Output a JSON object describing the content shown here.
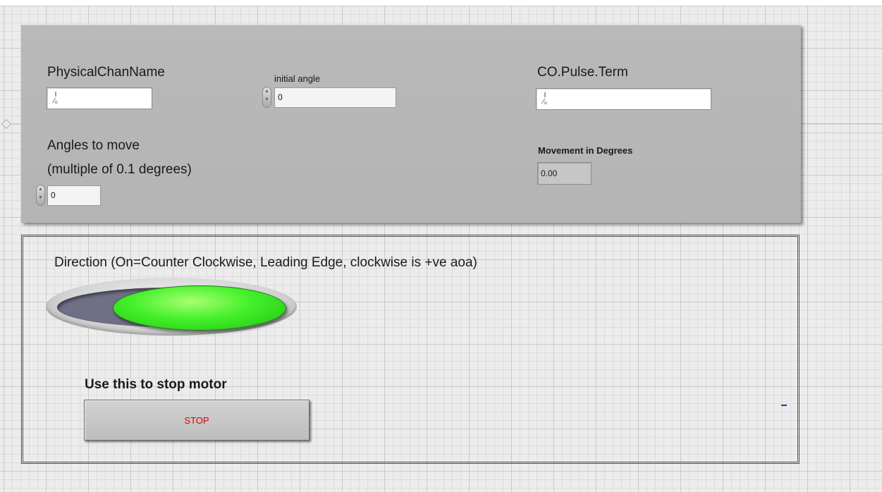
{
  "controls": {
    "physical_chan": {
      "label": "PhysicalChanName",
      "value": ""
    },
    "initial_angle": {
      "label": "initial angle",
      "value": "0"
    },
    "co_pulse_term": {
      "label": "CO.Pulse.Term",
      "value": ""
    },
    "angles_to_move": {
      "label_line1": "Angles to move",
      "label_line2": "(multiple of 0.1 degrees)",
      "value": "0"
    },
    "movement": {
      "label": "Movement in Degrees",
      "value": "0.00"
    }
  },
  "direction": {
    "label": "Direction (On=Counter Clockwise, Leading Edge,  clockwise is +ve aoa)",
    "state_on": true,
    "on_color": "#3be81f"
  },
  "stop": {
    "caption": "Use this to stop motor",
    "button_label": "STOP",
    "text_color": "#e00000"
  },
  "icons": {
    "io_name": "I/O",
    "io_glyph": "I⁄₀"
  }
}
